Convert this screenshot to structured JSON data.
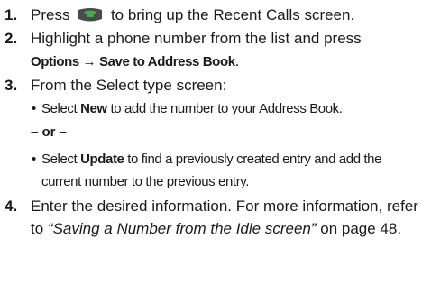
{
  "steps": [
    {
      "number": "1.",
      "before_icon": "Press",
      "icon": "send-call-key-icon",
      "after_icon": "to bring up the Recent Calls screen."
    },
    {
      "number": "2.",
      "line1": "Highlight a phone number from the list and press",
      "menu_path": "Options → Save to Address Book",
      "period": "."
    },
    {
      "number": "3.",
      "line1": "From the Select type screen:",
      "bullets": [
        {
          "pre": "Select ",
          "bold": "New",
          "post": " to add the number to your Address Book."
        },
        {
          "pre": "Select ",
          "bold": "Update",
          "post": " to find a previously created entry and add the current number to the previous entry."
        }
      ],
      "or_text": "– or –"
    },
    {
      "number": "4.",
      "line1": "Enter the desired information. For more information, refer to ",
      "ref_title": "“Saving a Number from the Idle screen”",
      "ref_page": " on page 48."
    }
  ],
  "colors": {
    "icon_key_body": "#4a4a4a",
    "icon_handset": "#3fae49",
    "text": "#1a1a1a"
  }
}
